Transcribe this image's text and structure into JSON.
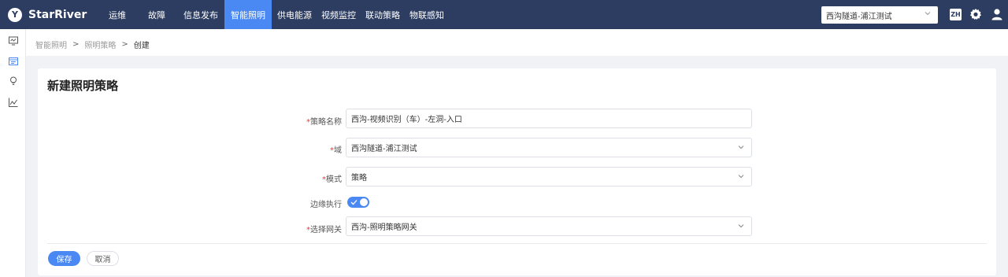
{
  "brand": {
    "name": "StarRiver",
    "logo_letter": "Y"
  },
  "nav": {
    "items": [
      {
        "label": "运维",
        "active": false
      },
      {
        "label": "故障",
        "active": false
      },
      {
        "label": "信息发布",
        "active": false
      },
      {
        "label": "智能照明",
        "active": true
      },
      {
        "label": "供电能源",
        "active": false
      },
      {
        "label": "视频监控",
        "active": false
      },
      {
        "label": "联动策略",
        "active": false
      },
      {
        "label": "物联感知",
        "active": false
      }
    ]
  },
  "header": {
    "domain_selected": "西沟隧道-浦江测试",
    "lang": "ZH"
  },
  "breadcrumb": {
    "items": [
      "智能照明",
      "照明策略",
      "创建"
    ]
  },
  "form": {
    "title": "新建照明策略",
    "fields": {
      "name": {
        "label": "策略名称",
        "required": true,
        "value": "西沟-视频识别（车）-左洞-入口"
      },
      "domain": {
        "label": "域",
        "required": true,
        "value": "西沟隧道-浦江测试"
      },
      "mode": {
        "label": "模式",
        "required": true,
        "value": "策略"
      },
      "edge": {
        "label": "边缘执行",
        "required": false,
        "on": true
      },
      "gateway": {
        "label": "选择网关",
        "required": true,
        "value": "西沟-照明策略网关"
      }
    },
    "required_mark": "*",
    "save_label": "保存",
    "cancel_label": "取消"
  },
  "colors": {
    "topbar": "#2d3d61",
    "accent": "#4a89f3",
    "required": "#e53935"
  }
}
